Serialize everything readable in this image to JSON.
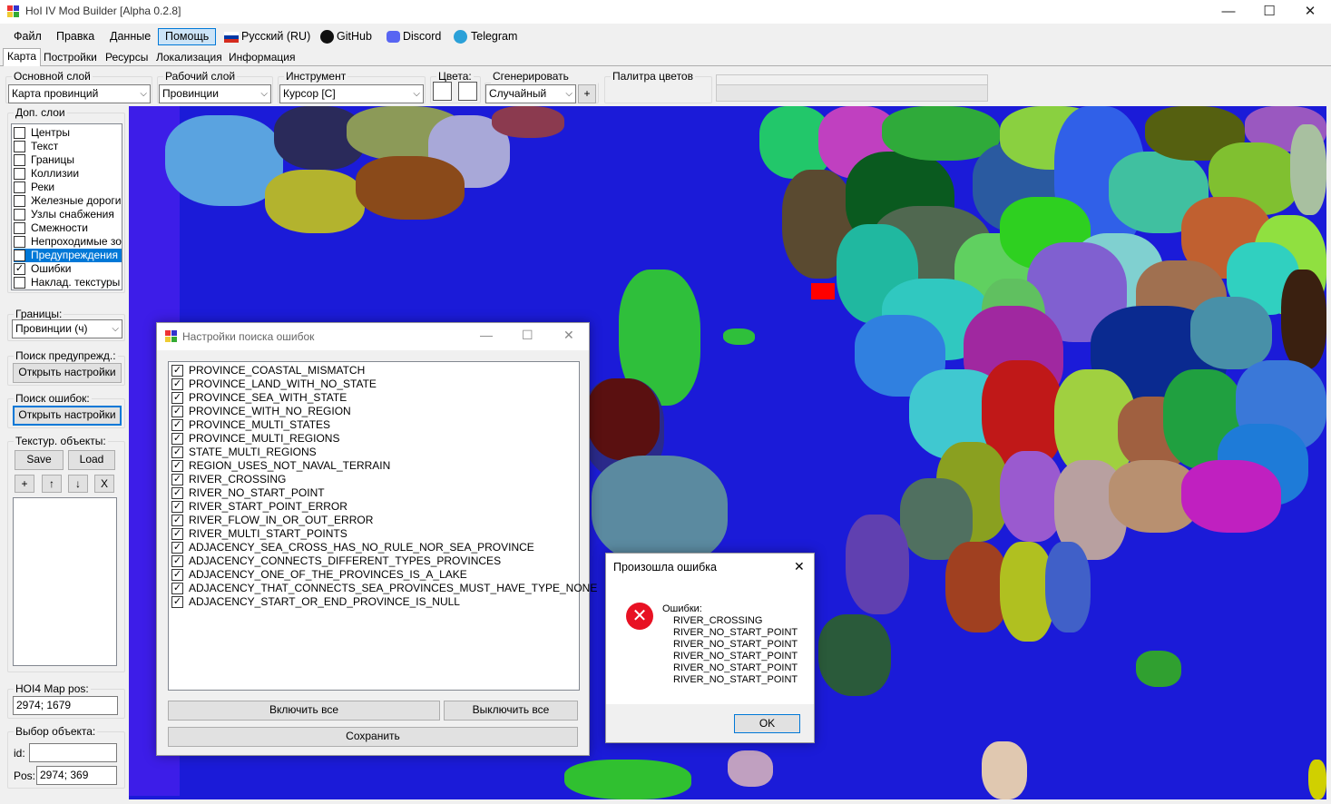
{
  "window": {
    "title": "HoI IV Mod Builder [Alpha 0.2.8]",
    "min": "—",
    "max": "☐",
    "close": "✕"
  },
  "menu": [
    "Файл",
    "Правка",
    "Данные",
    "Помощь",
    "Русский (RU)",
    "GitHub",
    "Discord",
    "Telegram"
  ],
  "tabs": [
    "Карта",
    "Постройки",
    "Ресурсы",
    "Локализация",
    "Информация"
  ],
  "toolbar": {
    "base_layer": {
      "label": "Основной слой",
      "value": "Карта провинций"
    },
    "work_layer": {
      "label": "Рабочий слой",
      "value": "Провинции"
    },
    "tool": {
      "label": "Инструмент",
      "value": "Курсор [C]"
    },
    "colors": {
      "label": "Цвета:"
    },
    "gen_color": {
      "label": "Сгенерировать цвет:",
      "value": "Случайный",
      "plus": "+"
    },
    "palette": {
      "label": "Палитра цветов"
    }
  },
  "layers": {
    "label": "Доп. слои",
    "items": [
      {
        "label": "Центры",
        "checked": false
      },
      {
        "label": "Текст",
        "checked": false
      },
      {
        "label": "Границы",
        "checked": false
      },
      {
        "label": "Коллизии",
        "checked": false
      },
      {
        "label": "Реки",
        "checked": false
      },
      {
        "label": "Железные дороги",
        "checked": false
      },
      {
        "label": "Узлы снабжения",
        "checked": false
      },
      {
        "label": "Смежности",
        "checked": false
      },
      {
        "label": "Непроходимые зоны",
        "checked": false
      },
      {
        "label": "Предупреждения",
        "checked": false
      },
      {
        "label": "Ошибки",
        "checked": true
      },
      {
        "label": "Наклад. текстуры",
        "checked": false
      }
    ]
  },
  "borders": {
    "label": "Границы:",
    "value": "Провинции (ч)"
  },
  "warn_search": {
    "label": "Поиск предупрежд.:",
    "button": "Открыть настройки"
  },
  "err_search": {
    "label": "Поиск ошибок:",
    "button": "Открыть настройки"
  },
  "textures": {
    "label": "Текстур. объекты:",
    "save": "Save",
    "load": "Load",
    "add": "+",
    "up": "↑",
    "down": "↓",
    "del": "X"
  },
  "map_pos": {
    "label": "HOI4 Map pos:",
    "value": "2974; 1679"
  },
  "obj_select": {
    "label": "Выбор объекта:",
    "id_label": "id:",
    "id_value": "",
    "pos_label": "Pos:",
    "pos_value": "2974; 369"
  },
  "error_settings": {
    "title": "Настройки поиска ошибок",
    "items": [
      "PROVINCE_COASTAL_MISMATCH",
      "PROVINCE_LAND_WITH_NO_STATE",
      "PROVINCE_SEA_WITH_STATE",
      "PROVINCE_WITH_NO_REGION",
      "PROVINCE_MULTI_STATES",
      "PROVINCE_MULTI_REGIONS",
      "STATE_MULTI_REGIONS",
      "REGION_USES_NOT_NAVAL_TERRAIN",
      "RIVER_CROSSING",
      "RIVER_NO_START_POINT",
      "RIVER_START_POINT_ERROR",
      "RIVER_FLOW_IN_OR_OUT_ERROR",
      "RIVER_MULTI_START_POINTS",
      "ADJACENCY_SEA_CROSS_HAS_NO_RULE_NOR_SEA_PROVINCE",
      "ADJACENCY_CONNECTS_DIFFERENT_TYPES_PROVINCES",
      "ADJACENCY_ONE_OF_THE_PROVINCES_IS_A_LAKE",
      "ADJACENCY_THAT_CONNECTS_SEA_PROVINCES_MUST_HAVE_TYPE_NONE",
      "ADJACENCY_START_OR_END_PROVINCE_IS_NULL"
    ],
    "enable_all": "Включить все",
    "disable_all": "Выключить все",
    "save": "Сохранить"
  },
  "error_dialog": {
    "title": "Произошла ошибка",
    "heading": "Ошибки:",
    "lines": [
      "RIVER_CROSSING",
      "RIVER_NO_START_POINT",
      "RIVER_NO_START_POINT",
      "RIVER_NO_START_POINT",
      "RIVER_NO_START_POINT",
      "RIVER_NO_START_POINT"
    ],
    "ok": "OK"
  },
  "colors": {
    "accent": "#0078d7",
    "sea": "#1b1bd8",
    "error_icon": "#e81123"
  }
}
